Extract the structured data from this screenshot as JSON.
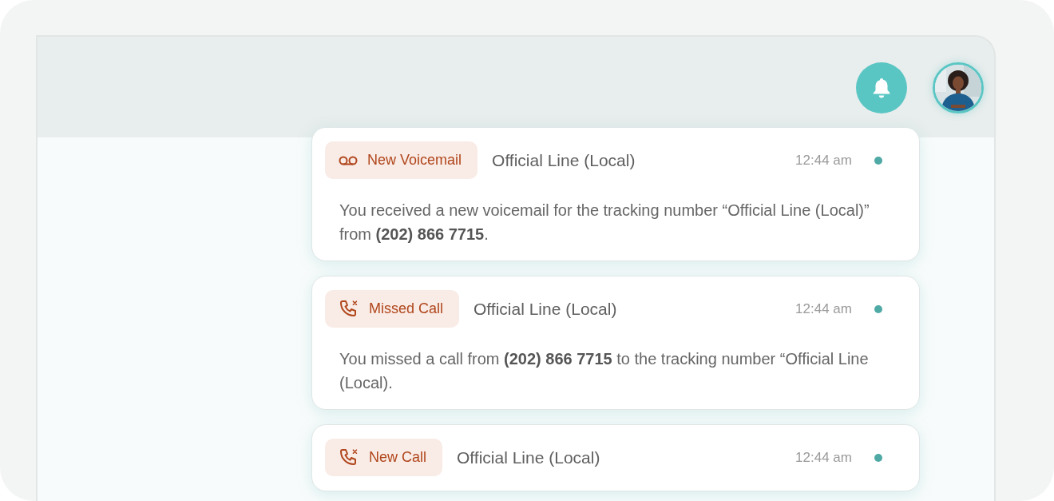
{
  "notifications": [
    {
      "badge": {
        "kind": "voicemail",
        "label": "New Voicemail"
      },
      "line": "Official Line (Local)",
      "time": "12:44 am",
      "unread": true,
      "message": "You received a new voicemail for the tracking number “Official Line (Local)” from **(202) 866 7715**."
    },
    {
      "badge": {
        "kind": "missed",
        "label": "Missed Call"
      },
      "line": "Official Line (Local)",
      "time": "12:44 am",
      "unread": true,
      "message": "You missed a call from **(202) 866 7715** to the tracking number “Official Line (Local)."
    },
    {
      "badge": {
        "kind": "missed",
        "label": "New Call"
      },
      "line": "Official Line (Local)",
      "time": "12:44 am",
      "unread": true
    }
  ]
}
